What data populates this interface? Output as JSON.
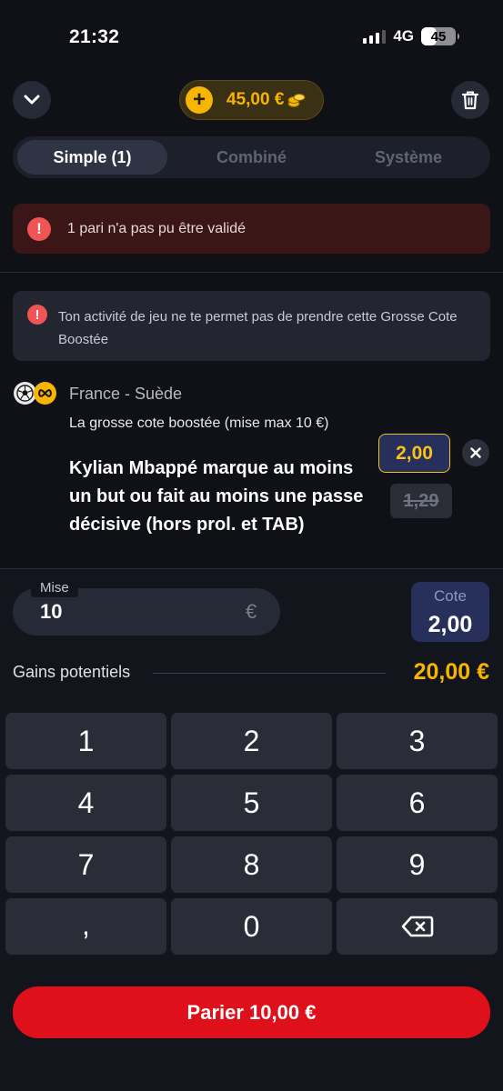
{
  "status_bar": {
    "time": "21:32",
    "network": "4G",
    "battery": "45",
    "battery_level_percent": 45
  },
  "header": {
    "balance": "45,00 €"
  },
  "tabs": [
    {
      "label": "Simple (1)",
      "active": true
    },
    {
      "label": "Combiné",
      "active": false
    },
    {
      "label": "Système",
      "active": false
    }
  ],
  "error_banner": {
    "message": "1 pari n'a pas pu être validé"
  },
  "warning": {
    "message": "Ton activité de jeu ne te permet pas de prendre cette Grosse Cote Boostée"
  },
  "selection": {
    "match": "France - Suède",
    "market": "La grosse cote boostée (mise max 10 €)",
    "pick": "Kylian Mbappé marque au moins un but ou fait au moins une passe décisive (hors prol. et TAB)",
    "boosted_odds": "2,00",
    "original_odds": "1,29"
  },
  "stake": {
    "label": "Mise",
    "value": "10",
    "currency": "€"
  },
  "odds_summary": {
    "label": "Cote",
    "value": "2,00"
  },
  "potential_gains": {
    "label": "Gains potentiels",
    "value": "20,00 €"
  },
  "keypad": {
    "keys": [
      "1",
      "2",
      "3",
      "4",
      "5",
      "6",
      "7",
      "8",
      "9",
      ",",
      "0"
    ]
  },
  "place_bet": {
    "label": "Parier 10,00 €"
  },
  "colors": {
    "background": "#0f1117",
    "accent_gold": "#f7b500",
    "error_red": "#f05454",
    "cta_red": "#e0101a",
    "odds_blue": "#26305a"
  },
  "icons": {
    "collapse": "chevron-down-icon",
    "trash": "trash-icon",
    "add_funds": "plus-icon",
    "coins": "coins-icon",
    "error": "exclamation-icon",
    "sport": "football-icon",
    "boost": "boost-icon",
    "remove": "close-icon",
    "backspace": "backspace-icon"
  }
}
